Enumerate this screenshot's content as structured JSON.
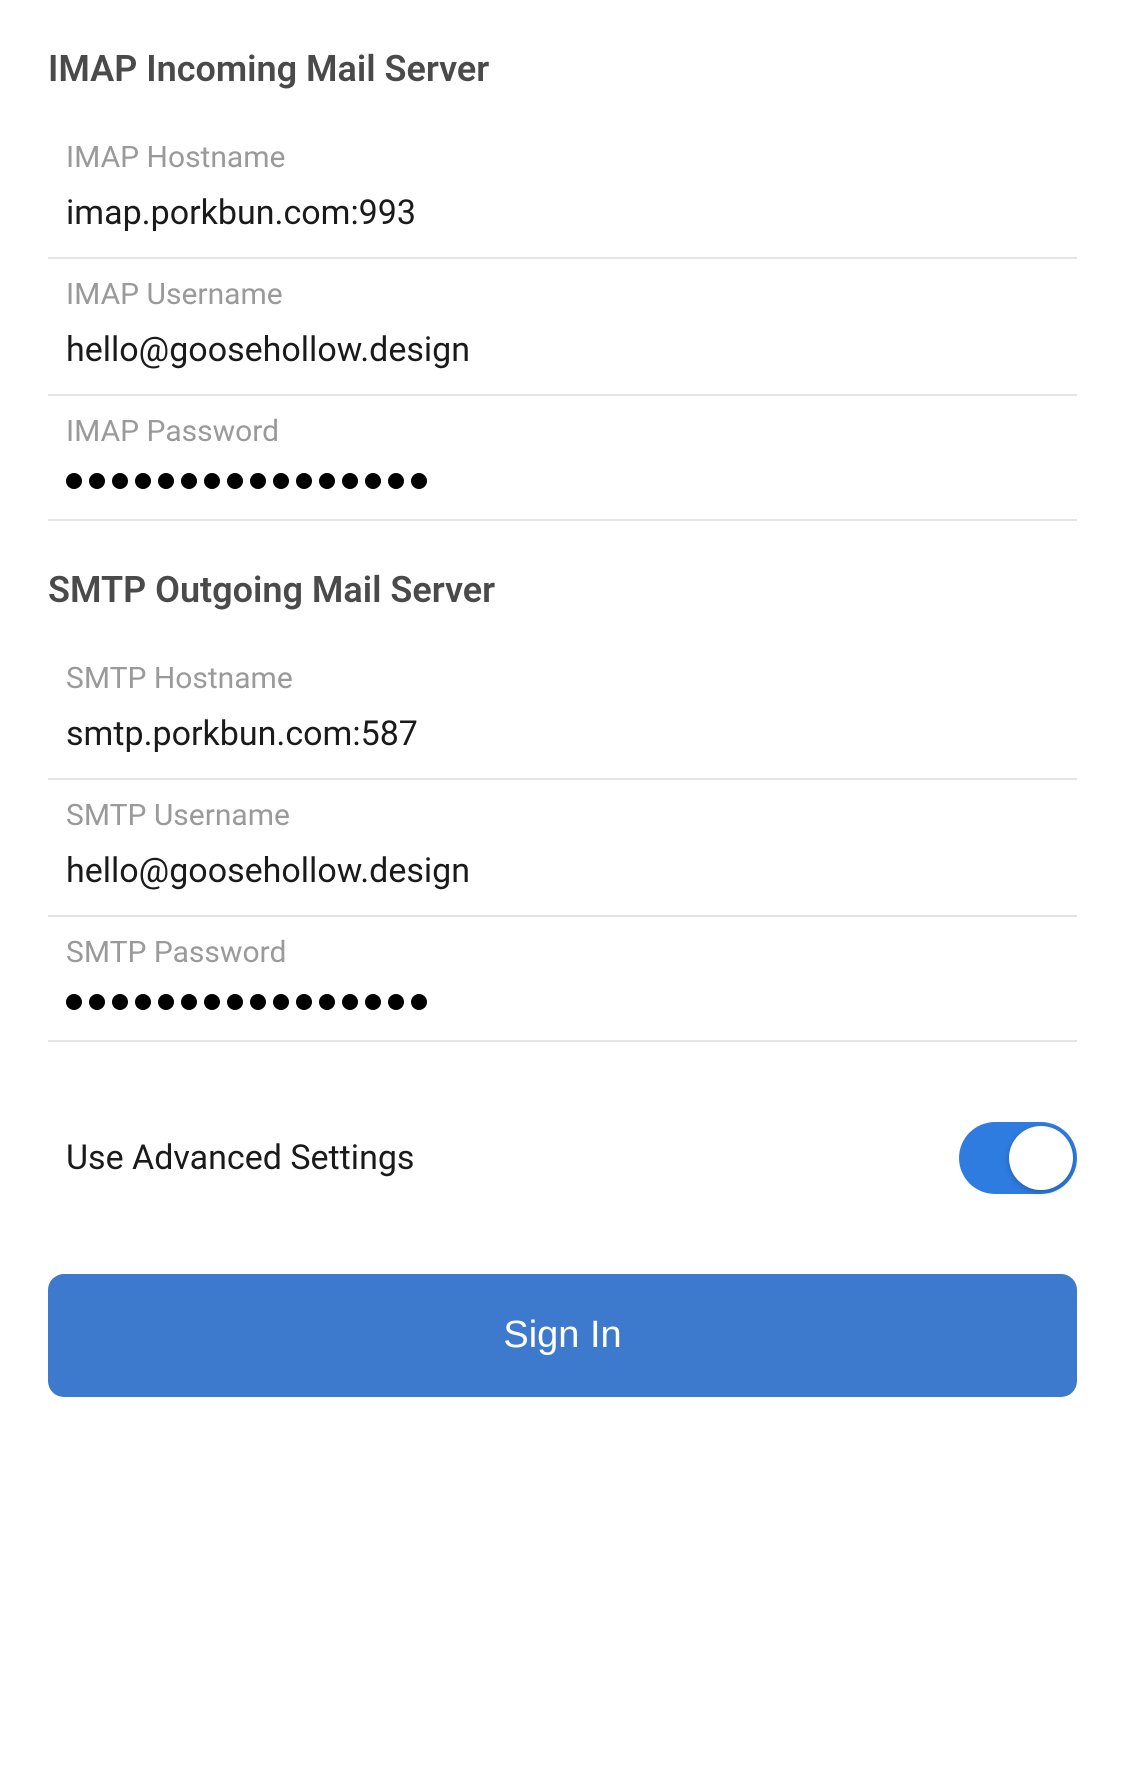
{
  "imap": {
    "section_title": "IMAP Incoming Mail Server",
    "hostname_label": "IMAP Hostname",
    "hostname_value": "imap.porkbun.com:993",
    "username_label": "IMAP Username",
    "username_value": "hello@goosehollow.design",
    "password_label": "IMAP Password",
    "password_dots": 16
  },
  "smtp": {
    "section_title": "SMTP Outgoing Mail Server",
    "hostname_label": "SMTP Hostname",
    "hostname_value": "smtp.porkbun.com:587",
    "username_label": "SMTP Username",
    "username_value": "hello@goosehollow.design",
    "password_label": "SMTP Password",
    "password_dots": 16
  },
  "advanced_toggle": {
    "label": "Use Advanced Settings",
    "enabled": true
  },
  "signin_button_label": "Sign In"
}
